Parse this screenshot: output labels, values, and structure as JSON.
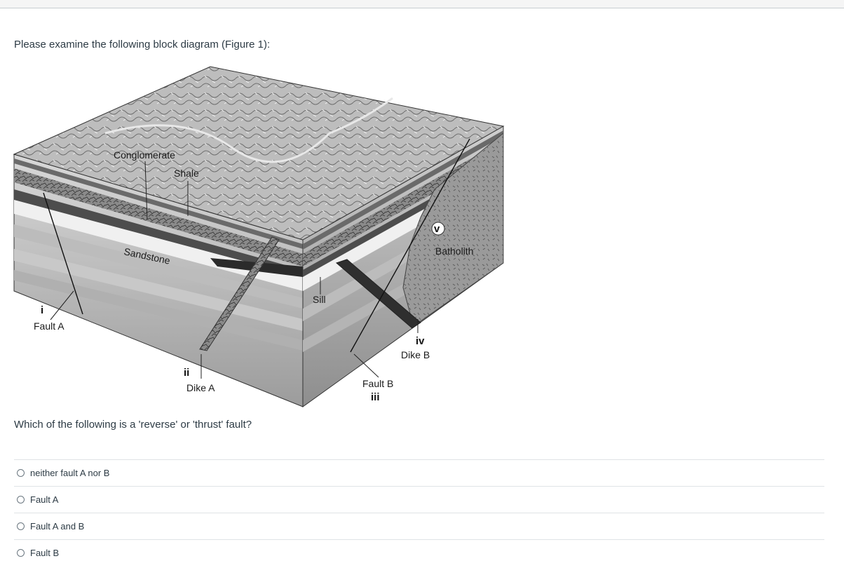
{
  "intro_text": "Please examine the following block diagram (Figure 1):",
  "question": "Which of the following is a 'reverse' or 'thrust' fault?",
  "diagram": {
    "labels": {
      "conglomerate": "Conglomerate",
      "shale": "Shale",
      "sandstone": "Sandstone",
      "sill": "Sill",
      "batholith": "Batholith",
      "fault_a": "Fault A",
      "fault_b": "Fault B",
      "dike_a": "Dike A",
      "dike_b": "Dike B"
    },
    "markers": {
      "i": "i",
      "ii": "ii",
      "iii": "iii",
      "iv": "iv",
      "v": "v"
    }
  },
  "answers": [
    "neither fault A nor B",
    "Fault A",
    "Fault A and B",
    "Fault B"
  ]
}
